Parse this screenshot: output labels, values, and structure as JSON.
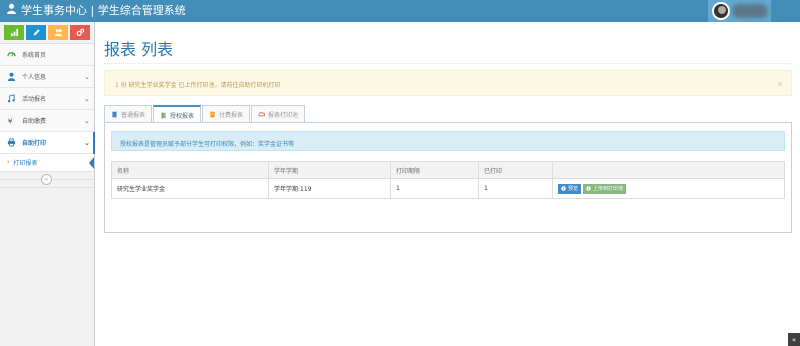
{
  "header": {
    "brand_title": "学生事务中心 | 学生综合管理系统"
  },
  "sidebar": {
    "shortcuts": [
      {
        "icon": "signal-icon",
        "color": "#68bc31"
      },
      {
        "icon": "pencil-icon",
        "color": "#2091cf"
      },
      {
        "icon": "users-icon",
        "color": "#ffb752"
      },
      {
        "icon": "cogs-icon",
        "color": "#e45c4f"
      }
    ],
    "items": [
      {
        "label": "系统首页",
        "icon": "dashboard-icon"
      },
      {
        "label": "个人信息",
        "icon": "user-icon"
      },
      {
        "label": "活动报名",
        "icon": "music-icon"
      },
      {
        "label": "自助缴费",
        "icon": "coins-icon"
      },
      {
        "label": "自助打印",
        "icon": "print-icon"
      }
    ],
    "sub_items": [
      {
        "label": "打印报表"
      }
    ]
  },
  "main": {
    "title": "报表 列表",
    "alert": "1 份 研究生学业奖学金 已上传打印池，请前往自助打印机打印",
    "alert_close": "×",
    "tabs": [
      {
        "label": "普通报表",
        "icon": "file-icon",
        "icon_color": "#428bca"
      },
      {
        "label": "授权报表",
        "icon": "book-icon",
        "icon_color": "#87b87f"
      },
      {
        "label": "付费报表",
        "icon": "receipt-icon",
        "icon_color": "#f89406"
      },
      {
        "label": "报表打印池",
        "icon": "cloud-icon",
        "icon_color": "#d15b47"
      }
    ],
    "info": "授权报表是管理员赋予部分学生可打印权限，例如：奖学金证书等",
    "table": {
      "headers": [
        "名称",
        "学年学期",
        "打印期限",
        "已打印",
        ""
      ],
      "rows": [
        {
          "name": "研究生学业奖学金",
          "term": "学年学期:119",
          "limit": "1",
          "printed": "1",
          "actions": [
            "预览",
            "上传到打印池"
          ]
        }
      ]
    }
  },
  "scroll_top_label": "«"
}
